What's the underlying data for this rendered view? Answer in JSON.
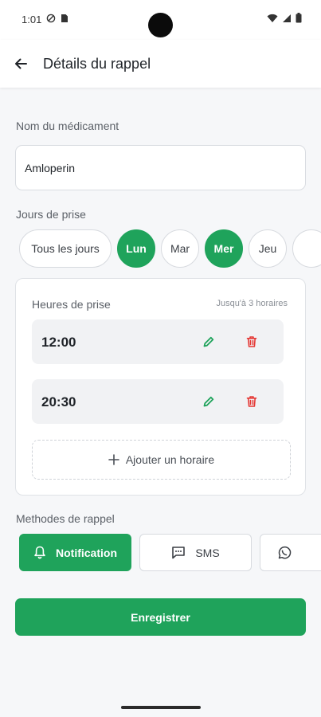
{
  "status_bar": {
    "time": "1:01"
  },
  "header": {
    "title": "Détails du rappel"
  },
  "medication": {
    "label": "Nom du médicament",
    "value": "Amloperin"
  },
  "days": {
    "label": "Jours de prise",
    "items": [
      {
        "label": "Tous les jours",
        "selected": false
      },
      {
        "label": "Lun",
        "selected": true
      },
      {
        "label": "Mar",
        "selected": false
      },
      {
        "label": "Mer",
        "selected": true
      },
      {
        "label": "Jeu",
        "selected": false
      }
    ]
  },
  "hours": {
    "title": "Heures de prise",
    "limit": "Jusqu'à 3 horaires",
    "times": [
      "12:00",
      "20:30"
    ],
    "add_label": "Ajouter un horaire"
  },
  "methods": {
    "label": "Methodes de rappel",
    "items": [
      {
        "label": "Notification",
        "icon": "bell-icon",
        "selected": true
      },
      {
        "label": "SMS",
        "icon": "message-icon",
        "selected": false
      },
      {
        "label": "",
        "icon": "whatsapp-icon",
        "selected": false
      }
    ]
  },
  "save_label": "Enregistrer",
  "colors": {
    "accent": "#1fa35b",
    "delete": "#e53935",
    "edit": "#1fa35b"
  }
}
